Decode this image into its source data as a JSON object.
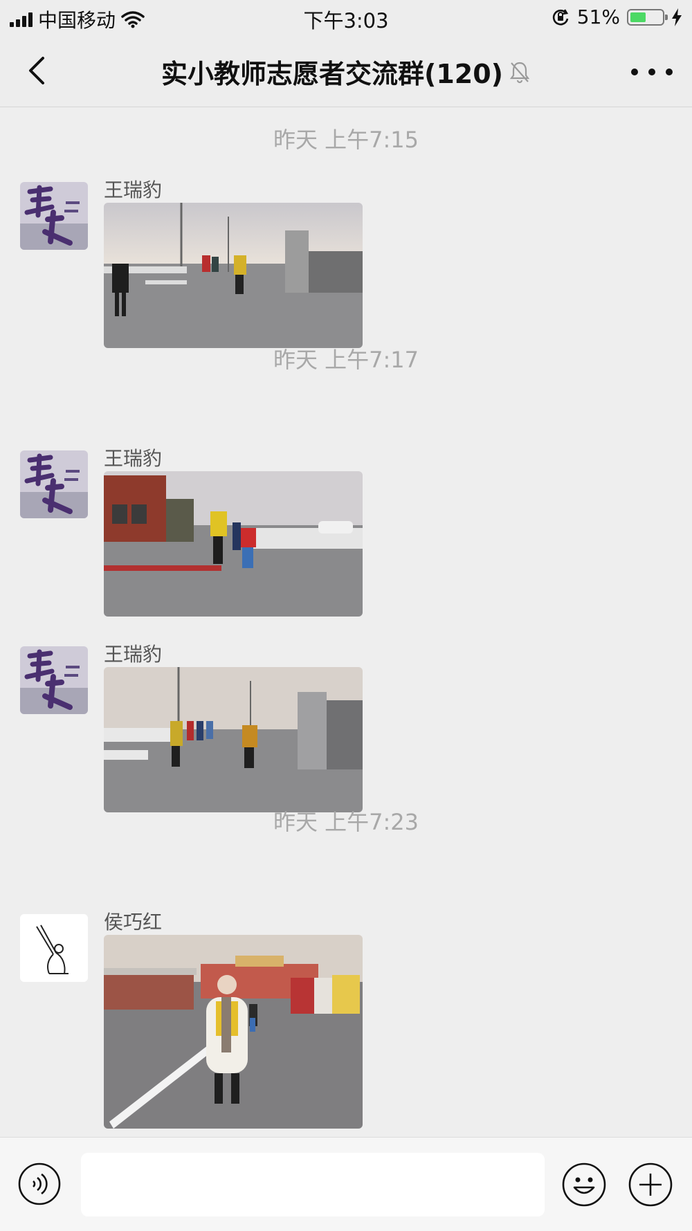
{
  "status_bar": {
    "carrier": "中国移动",
    "time": "下午3:03",
    "battery_percent": "51%",
    "battery_level": 0.51,
    "icons": [
      "signal-icon",
      "wifi-icon",
      "rotation-lock-icon",
      "battery-icon",
      "charging-icon"
    ]
  },
  "nav": {
    "title": "实小教师志愿者交流群(120)",
    "icons": [
      "back-icon",
      "mute-bell-icon",
      "more-icon"
    ]
  },
  "messages": [
    {
      "timestamp": "昨天 上午7:15",
      "sender": "王瑞豹",
      "avatar": "purple-calligraphy-avatar",
      "photo": "volunteers-at-school-gate-photo"
    },
    {
      "timestamp": "昨天 上午7:17",
      "sender": "王瑞豹",
      "avatar": "purple-calligraphy-avatar",
      "photo": "volunteer-with-student-photo"
    },
    {
      "timestamp": "",
      "sender": "王瑞豹",
      "avatar": "purple-calligraphy-avatar",
      "photo": "volunteers-at-crossing-photo"
    },
    {
      "timestamp": "昨天 上午7:23",
      "sender": "侯巧红",
      "avatar": "sketch-figure-avatar",
      "photo": "teacher-in-white-coat-photo"
    }
  ],
  "input_bar": {
    "placeholder": "",
    "icons": [
      "voice-icon",
      "emoji-icon",
      "plus-icon"
    ]
  }
}
